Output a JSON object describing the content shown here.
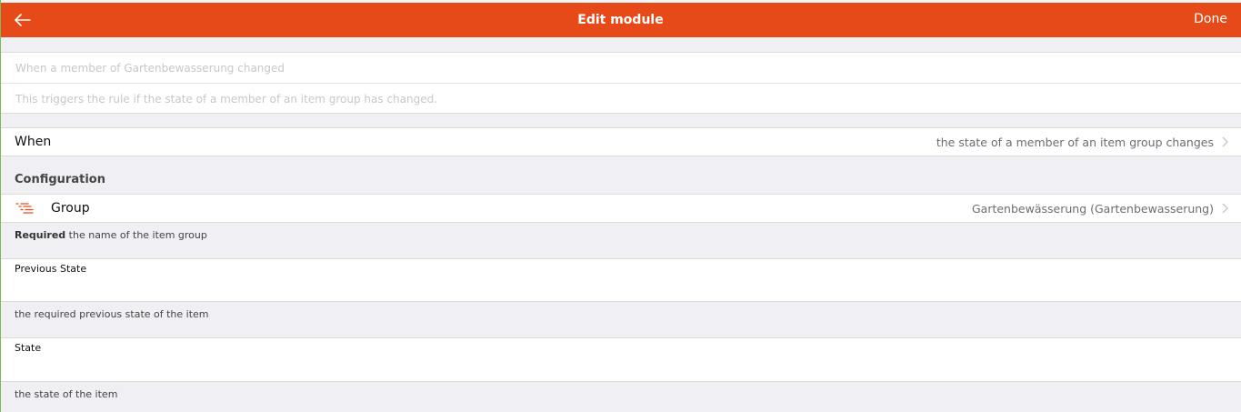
{
  "navbar": {
    "title": "Edit module",
    "done_label": "Done",
    "back_icon": "arrow-left-icon",
    "color": "#e64a19"
  },
  "module": {
    "label_placeholder": "When a member of Gartenbewässerung changed",
    "label_placeholder_display": "When a member of Gartenbewasserung changed",
    "description_placeholder": "This triggers the rule if the state of a member of an item group has changed."
  },
  "when_row": {
    "title": "When",
    "value": "the state of a member of an item group changes"
  },
  "configuration": {
    "title": "Configuration",
    "group": {
      "title": "Group",
      "value": "Gartenbewässerung (Gartenbewasserung)",
      "icon": "list-icon",
      "required_label": "Required",
      "description": "the name of the item group"
    },
    "previous_state": {
      "label": "Previous State",
      "value": "",
      "description": "the required previous state of the item"
    },
    "state": {
      "label": "State",
      "value": "",
      "description": "the state of the item"
    }
  }
}
